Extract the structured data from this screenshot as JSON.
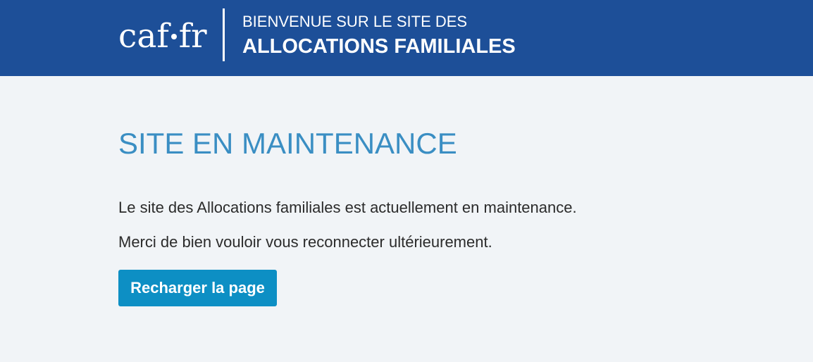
{
  "header": {
    "logo_text_left": "caf",
    "logo_text_right": "fr",
    "welcome_line1": "BIENVENUE SUR LE SITE DES",
    "welcome_line2": "ALLOCATIONS FAMILIALES"
  },
  "main": {
    "title": "SITE EN MAINTENANCE",
    "message_1": "Le site des Allocations familiales est actuellement en maintenance.",
    "message_2": "Merci de bien vouloir vous reconnecter ultérieurement.",
    "reload_button_label": "Recharger la page"
  },
  "colors": {
    "header_background": "#1d4f98",
    "page_background": "#f1f4f7",
    "title": "#3a8ec3",
    "button": "#0d8fc4"
  }
}
